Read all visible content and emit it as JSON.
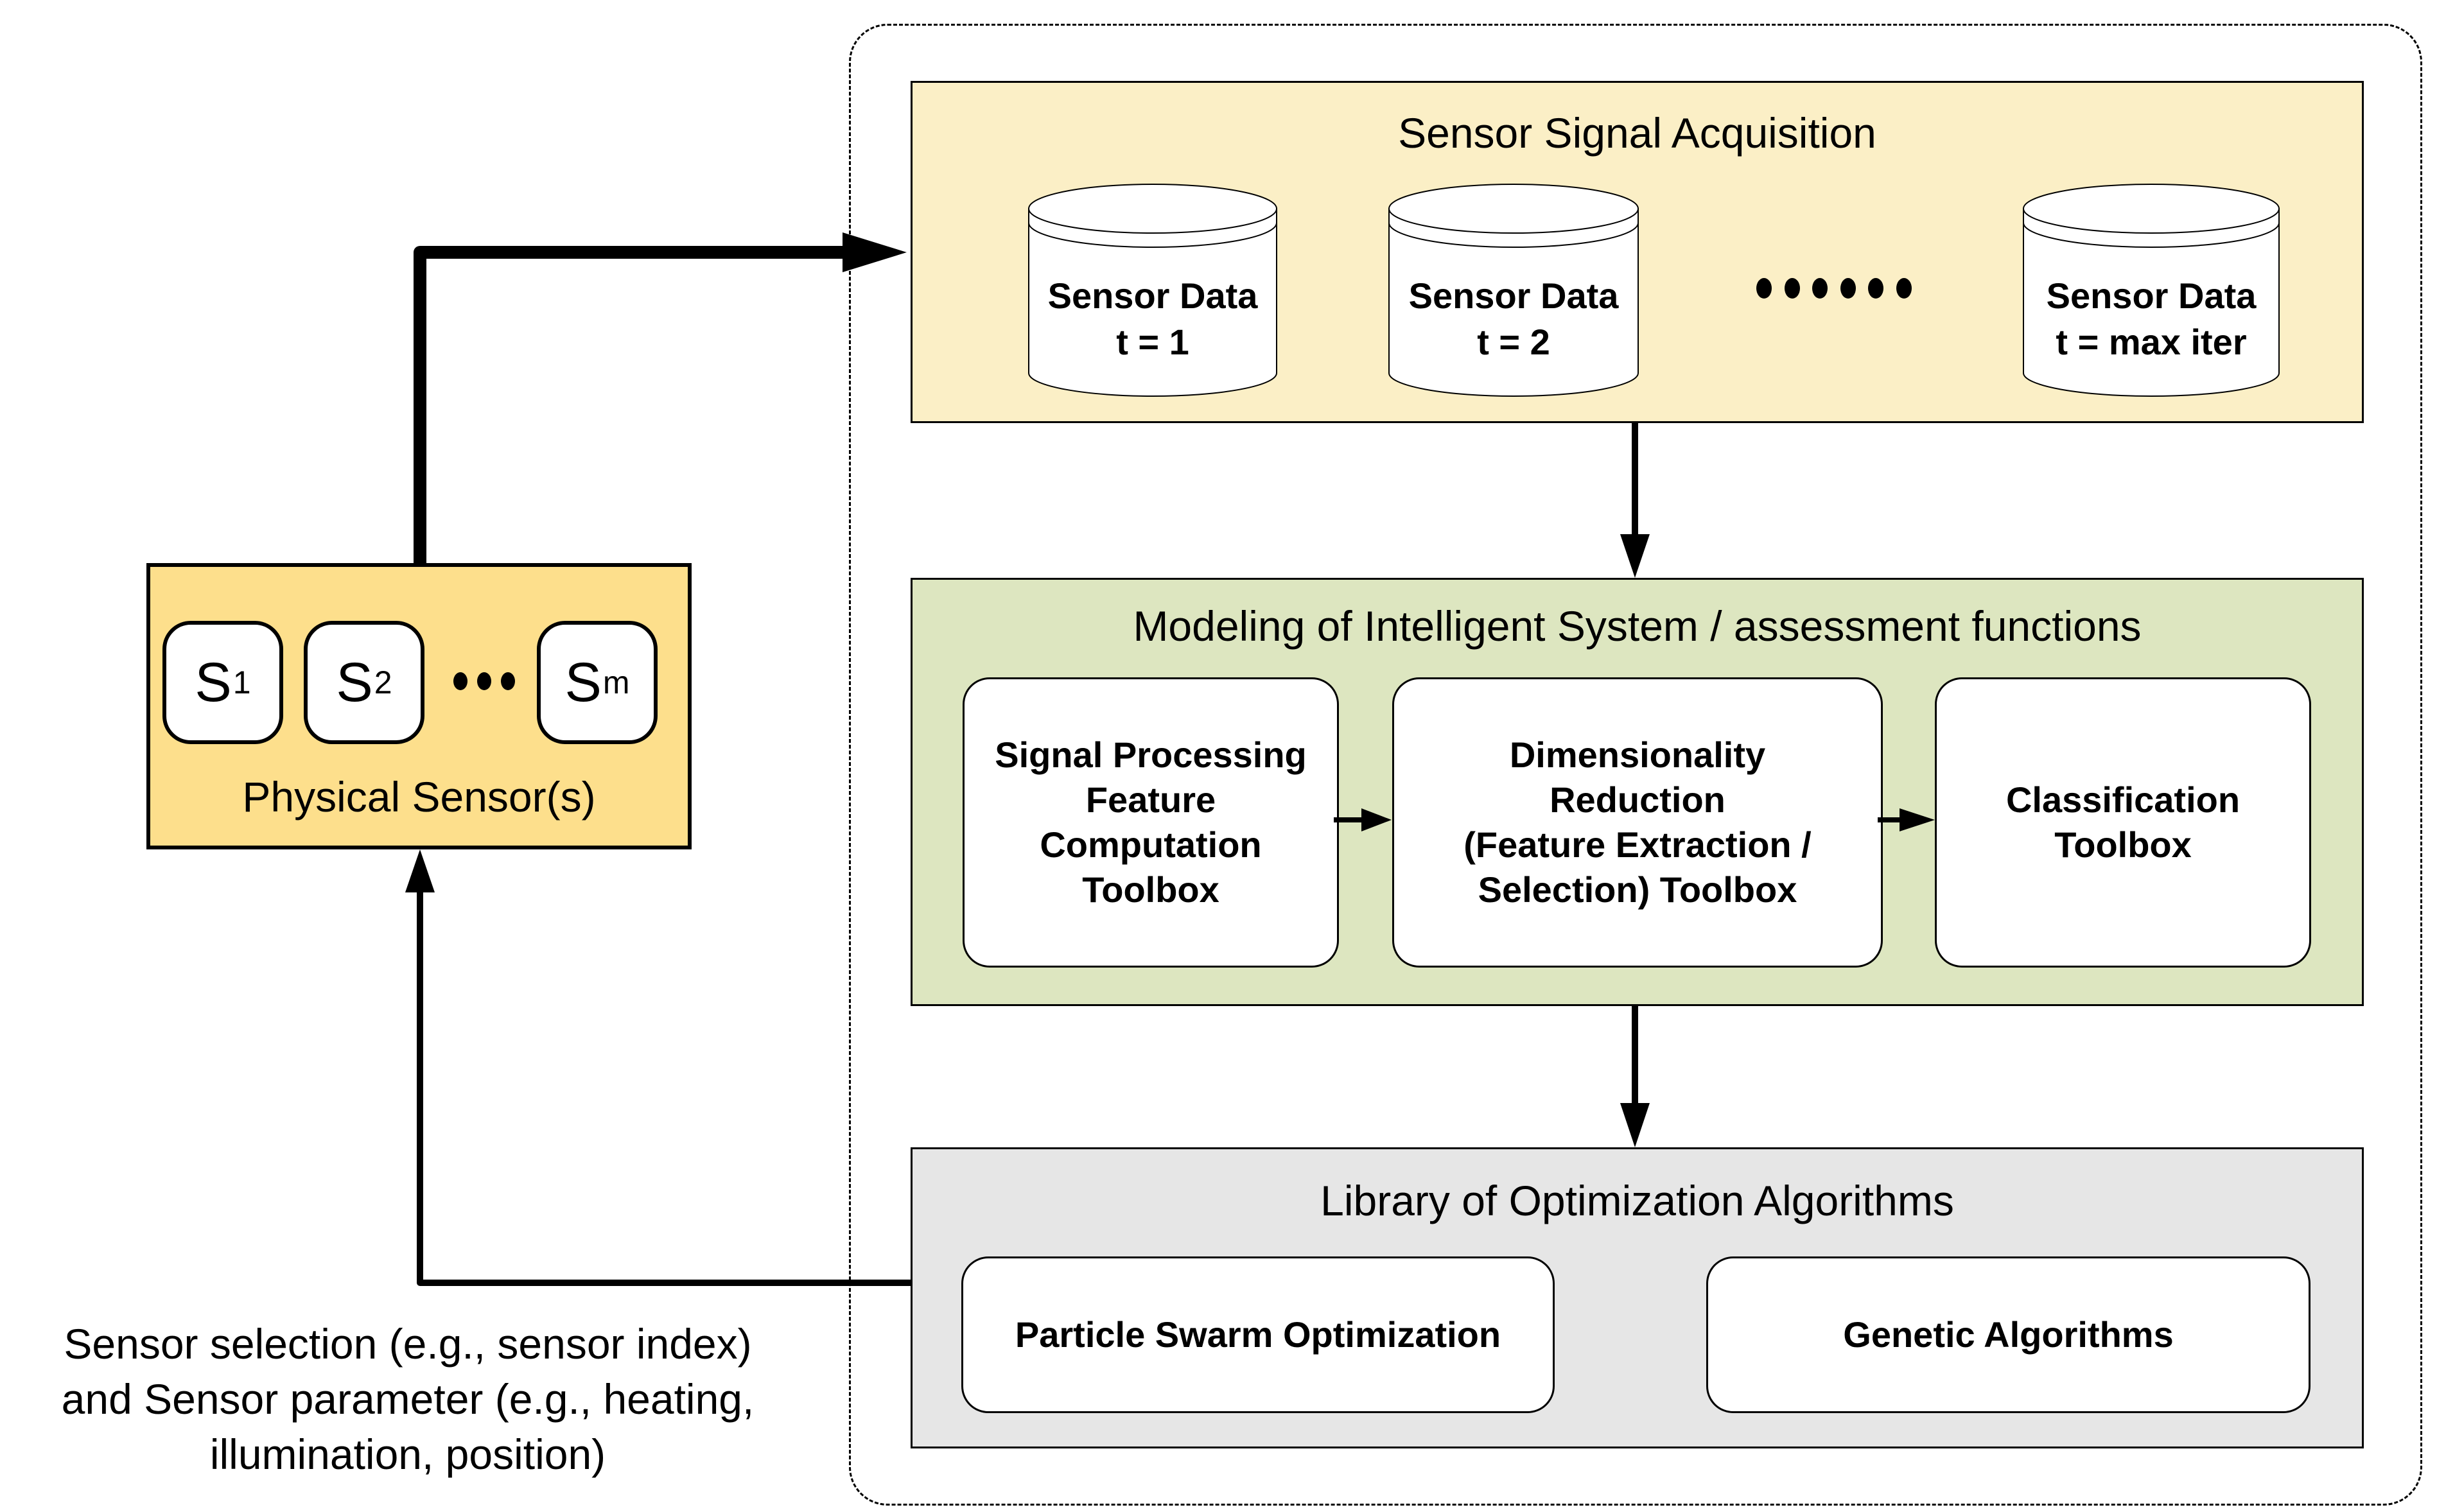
{
  "diagram": {
    "colors": {
      "acquisition_fill": "#fbefc6",
      "modeling_fill": "#dde6c0",
      "optimization_fill": "#e6e6e6",
      "physical_sensor_fill": "#fddf8c",
      "box_fill": "#ffffff",
      "stroke": "#000000"
    },
    "physical_sensors": {
      "label": "Physical Sensor(s)",
      "sensors": [
        {
          "base": "S",
          "sub": "1"
        },
        {
          "base": "S",
          "sub": "2"
        },
        {
          "base": "S",
          "sub": "m"
        }
      ],
      "ellipsis": "•••"
    },
    "acquisition": {
      "title": "Sensor Signal Acquisition",
      "stores": [
        {
          "line1": "Sensor Data",
          "line2": "t = 1"
        },
        {
          "line1": "Sensor Data",
          "line2": "t = 2"
        },
        {
          "line1": "Sensor Data",
          "line2": "t = max iter"
        }
      ],
      "ellipsis": "••••••"
    },
    "modeling": {
      "title": "Modeling of Intelligent System / assessment functions",
      "toolboxes": [
        {
          "label": "Signal Processing\nFeature\nComputation\nToolbox"
        },
        {
          "label": "Dimensionality\nReduction\n(Feature Extraction /\nSelection) Toolbox"
        },
        {
          "label": "Classification\nToolbox"
        }
      ]
    },
    "optimization": {
      "title": "Library of Optimization Algorithms",
      "algorithms": [
        {
          "label": "Particle Swarm Optimization"
        },
        {
          "label": "Genetic Algorithms"
        }
      ]
    },
    "feedback_caption": "Sensor selection (e.g., sensor index)\nand Sensor parameter (e.g., heating,\nillumination, position)"
  }
}
